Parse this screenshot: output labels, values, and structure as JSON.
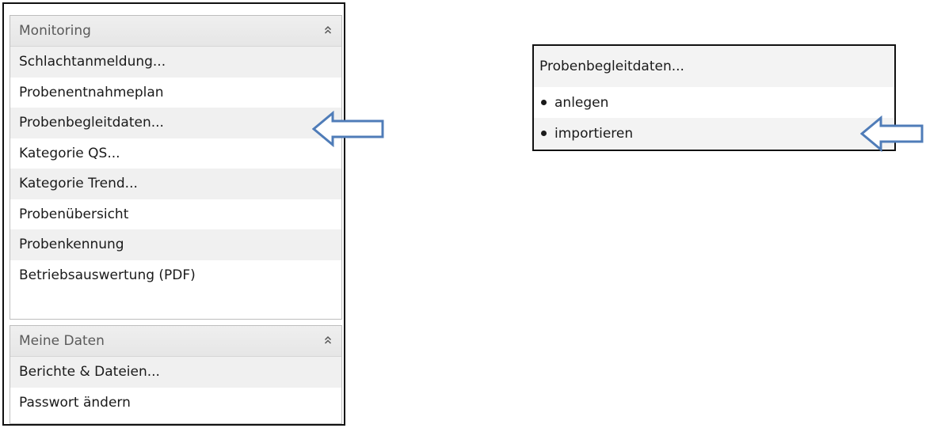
{
  "monitoring": {
    "title": "Monitoring",
    "collapse_icon": "double-chevron-up-icon",
    "items": [
      {
        "label": "Schlachtanmeldung..."
      },
      {
        "label": "Probenentnahmeplan"
      },
      {
        "label": "Probenbegleitdaten..."
      },
      {
        "label": "Kategorie QS..."
      },
      {
        "label": "Kategorie Trend..."
      },
      {
        "label": "Probenübersicht"
      },
      {
        "label": "Probenkennung"
      },
      {
        "label": "Betriebsauswertung (PDF)"
      }
    ]
  },
  "meine_daten": {
    "title": "Meine Daten",
    "collapse_icon": "double-chevron-up-icon",
    "items": [
      {
        "label": "Berichte & Dateien..."
      },
      {
        "label": "Passwort ändern"
      }
    ]
  },
  "submenu": {
    "title": "Probenbegleitdaten...",
    "items": [
      {
        "label": "anlegen"
      },
      {
        "label": "importieren"
      }
    ]
  },
  "colors": {
    "arrow_stroke": "#4f7cb8",
    "frame": "#111111",
    "panel_border": "#bdbdbd",
    "alt_row": "#f0f0f0"
  },
  "annotations": {
    "arrow_left": "arrow-icon",
    "arrow_right": "arrow-icon"
  }
}
